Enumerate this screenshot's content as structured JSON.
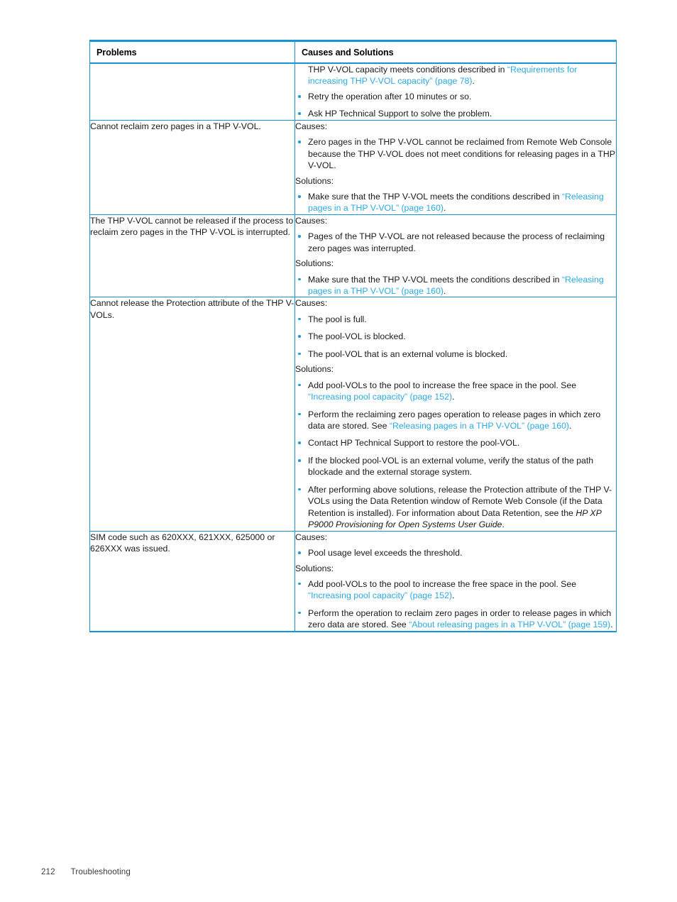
{
  "document": {
    "footer": {
      "page_number": "212",
      "section": "Troubleshooting"
    }
  },
  "colors": {
    "rule_blue": "#1296d4",
    "link_blue": "#2ba9e0",
    "bullet_blue": "#1f9bd8",
    "text": "#1a1a1a"
  },
  "table": {
    "headers": {
      "col1": "Problems",
      "col2": "Causes and Solutions"
    },
    "rows": [
      {
        "problem": "",
        "blocks": [
          {
            "type": "lead",
            "parts": [
              {
                "text": "THP V-VOL capacity meets conditions described in ",
                "style": "normal"
              },
              {
                "text": "“Requirements for increasing THP V-VOL capacity” (page 78)",
                "style": "link"
              },
              {
                "text": ".",
                "style": "normal"
              }
            ]
          },
          {
            "type": "bullets",
            "items": [
              {
                "parts": [
                  {
                    "text": "Retry the operation after 10 minutes or so.",
                    "style": "normal"
                  }
                ]
              },
              {
                "parts": [
                  {
                    "text": "Ask HP Technical Support to solve the problem.",
                    "style": "normal"
                  }
                ]
              }
            ]
          }
        ]
      },
      {
        "problem": "Cannot reclaim zero pages in a THP V-VOL.",
        "blocks": [
          {
            "type": "plain",
            "parts": [
              {
                "text": "Causes:",
                "style": "normal"
              }
            ]
          },
          {
            "type": "bullets",
            "items": [
              {
                "parts": [
                  {
                    "text": "Zero pages in the THP V-VOL cannot be reclaimed from Remote Web Console because the THP V-VOL does not meet conditions for releasing pages in a THP V-VOL.",
                    "style": "normal"
                  }
                ]
              }
            ]
          },
          {
            "type": "plain",
            "parts": [
              {
                "text": "Solutions:",
                "style": "normal"
              }
            ]
          },
          {
            "type": "bullets",
            "items": [
              {
                "parts": [
                  {
                    "text": "Make sure that the THP V-VOL meets the conditions described in ",
                    "style": "normal"
                  },
                  {
                    "text": "“Releasing pages in a THP V-VOL” (page 160)",
                    "style": "link"
                  },
                  {
                    "text": ".",
                    "style": "normal"
                  }
                ]
              }
            ]
          }
        ]
      },
      {
        "problem": "The THP V-VOL cannot be released if the process to reclaim zero pages in the THP V-VOL is interrupted.",
        "blocks": [
          {
            "type": "plain",
            "parts": [
              {
                "text": "Causes:",
                "style": "normal"
              }
            ]
          },
          {
            "type": "bullets",
            "items": [
              {
                "parts": [
                  {
                    "text": "Pages of the THP V-VOL are not released because the process of reclaiming zero pages was interrupted.",
                    "style": "normal"
                  }
                ]
              }
            ]
          },
          {
            "type": "plain",
            "parts": [
              {
                "text": "Solutions:",
                "style": "normal"
              }
            ]
          },
          {
            "type": "bullets",
            "items": [
              {
                "parts": [
                  {
                    "text": "Make sure that the THP V-VOL meets the conditions described in ",
                    "style": "normal"
                  },
                  {
                    "text": "“Releasing pages in a THP V-VOL” (page 160)",
                    "style": "link"
                  },
                  {
                    "text": ".",
                    "style": "normal"
                  }
                ]
              }
            ]
          }
        ]
      },
      {
        "problem": "Cannot release the Protection attribute of the THP V-VOLs.",
        "blocks": [
          {
            "type": "plain",
            "parts": [
              {
                "text": "Causes:",
                "style": "normal"
              }
            ]
          },
          {
            "type": "bullets",
            "items": [
              {
                "parts": [
                  {
                    "text": "The pool is full.",
                    "style": "normal"
                  }
                ]
              },
              {
                "parts": [
                  {
                    "text": "The pool-VOL is blocked.",
                    "style": "normal"
                  }
                ]
              },
              {
                "parts": [
                  {
                    "text": "The pool-VOL that is an external volume is blocked.",
                    "style": "normal"
                  }
                ]
              }
            ]
          },
          {
            "type": "plain",
            "parts": [
              {
                "text": "Solutions:",
                "style": "normal"
              }
            ]
          },
          {
            "type": "bullets",
            "items": [
              {
                "parts": [
                  {
                    "text": "Add pool-VOLs to the pool to increase the free space in the pool. See ",
                    "style": "normal"
                  },
                  {
                    "text": "“Increasing pool capacity” (page 152)",
                    "style": "link"
                  },
                  {
                    "text": ".",
                    "style": "normal"
                  }
                ]
              },
              {
                "parts": [
                  {
                    "text": "Perform the reclaiming zero pages operation to release pages in which zero data are stored. See ",
                    "style": "normal"
                  },
                  {
                    "text": "“Releasing pages in a THP V-VOL” (page 160)",
                    "style": "link"
                  },
                  {
                    "text": ".",
                    "style": "normal"
                  }
                ]
              },
              {
                "parts": [
                  {
                    "text": "Contact HP Technical Support to restore the pool-VOL.",
                    "style": "normal"
                  }
                ]
              },
              {
                "parts": [
                  {
                    "text": "If the blocked pool-VOL is an external volume, verify the status of the path blockade and the external storage system.",
                    "style": "normal"
                  }
                ]
              },
              {
                "parts": [
                  {
                    "text": "After performing above solutions, release the Protection attribute of the THP V-VOLs using the Data Retention window of Remote Web Console (if the Data Retention is installed). For information about Data Retention, see the ",
                    "style": "normal"
                  },
                  {
                    "text": "HP XP P9000 Provisioning for Open Systems User Guide",
                    "style": "italic"
                  },
                  {
                    "text": ".",
                    "style": "normal"
                  }
                ]
              }
            ]
          }
        ]
      },
      {
        "problem": "SIM code such as 620XXX, 621XXX, 625000 or 626XXX was issued.",
        "blocks": [
          {
            "type": "plain",
            "parts": [
              {
                "text": "Causes:",
                "style": "normal"
              }
            ]
          },
          {
            "type": "bullets",
            "items": [
              {
                "parts": [
                  {
                    "text": "Pool usage level exceeds the threshold.",
                    "style": "normal"
                  }
                ]
              }
            ]
          },
          {
            "type": "plain",
            "parts": [
              {
                "text": "Solutions:",
                "style": "normal"
              }
            ]
          },
          {
            "type": "bullets",
            "items": [
              {
                "parts": [
                  {
                    "text": "Add pool-VOLs to the pool to increase the free space in the pool. See ",
                    "style": "normal"
                  },
                  {
                    "text": "“Increasing pool capacity” (page 152)",
                    "style": "link"
                  },
                  {
                    "text": ".",
                    "style": "normal"
                  }
                ]
              },
              {
                "parts": [
                  {
                    "text": "Perform the operation to reclaim zero pages in order to release pages in which zero data are stored. See ",
                    "style": "normal"
                  },
                  {
                    "text": "“About releasing pages in a THP V-VOL” (page 159)",
                    "style": "link"
                  },
                  {
                    "text": ".",
                    "style": "normal"
                  }
                ]
              }
            ]
          }
        ]
      }
    ]
  }
}
